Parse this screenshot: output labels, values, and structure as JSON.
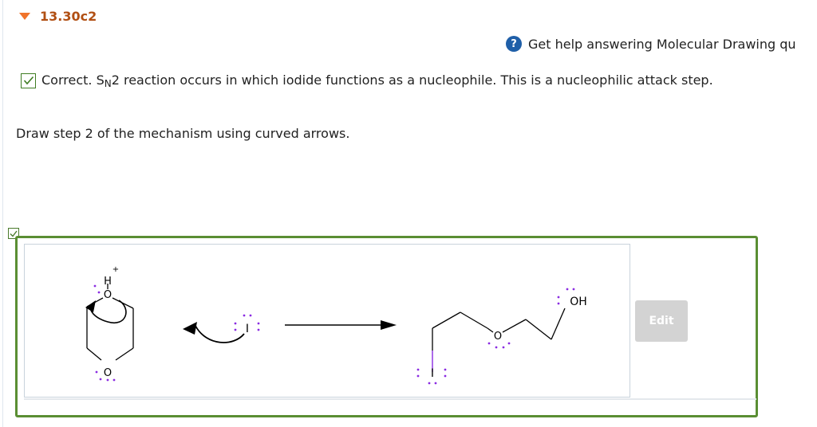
{
  "question": {
    "id": "13.30c2"
  },
  "help": {
    "icon": "question-circle-icon",
    "text": "Get help answering Molecular Drawing qu"
  },
  "feedback": {
    "status_icon": "check-icon",
    "prefix": "Correct. S",
    "subscript": "N",
    "rest": "2 reaction occurs in which iodide functions as a nucleophile. This is a nucleophilic attack step."
  },
  "prompt": "Draw step 2 of the mechanism using curved arrows.",
  "drawing": {
    "reactant_labels": {
      "h": "H",
      "charge": "+",
      "o_top": "O",
      "o_bottom": "O"
    },
    "nucleophile_label": "I",
    "product_labels": {
      "oh": "OH",
      "o_ether": "O",
      "iodine": "I"
    },
    "colors": {
      "lone_pair": "#8a2be2",
      "bond": "#000000"
    }
  },
  "edit_button": {
    "label": "Edit"
  },
  "colors": {
    "accent_green": "#5a8e33",
    "header_orange": "#f0732a",
    "id_color": "#b14f13",
    "help_blue": "#1f5fa8"
  }
}
